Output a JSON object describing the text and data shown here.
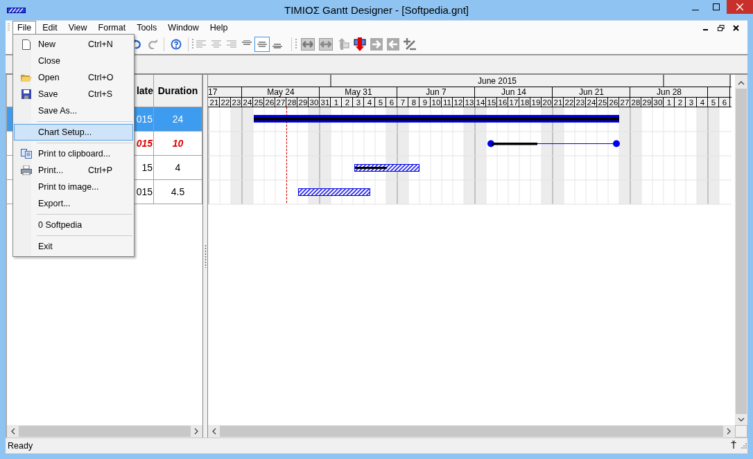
{
  "window": {
    "title": "TIMIOΣ Gantt Designer - [Softpedia.gnt]"
  },
  "menu_bar": [
    {
      "label": "File",
      "selected": true
    },
    {
      "label": "Edit",
      "selected": false
    },
    {
      "label": "View",
      "selected": false
    },
    {
      "label": "Format",
      "selected": false
    },
    {
      "label": "Tools",
      "selected": false
    },
    {
      "label": "Window",
      "selected": false
    },
    {
      "label": "Help",
      "selected": false
    }
  ],
  "file_menu": {
    "groups": [
      [
        {
          "label": "New",
          "shortcut": "Ctrl+N",
          "selected": false
        },
        {
          "label": "Close",
          "selected": false
        },
        {
          "label": "Open",
          "shortcut": "Ctrl+O",
          "selected": false
        },
        {
          "label": "Save",
          "shortcut": "Ctrl+S",
          "selected": false
        },
        {
          "label": "Save As...",
          "selected": false
        }
      ],
      [
        {
          "label": "Chart Setup...",
          "selected": true
        }
      ],
      [
        {
          "label": "Print to clipboard...",
          "selected": false
        },
        {
          "label": "Print...",
          "shortcut": "Ctrl+P",
          "selected": false
        },
        {
          "label": "Print to image...",
          "selected": false
        },
        {
          "label": "Export...",
          "selected": false
        }
      ],
      [
        {
          "label": "0 Softpedia",
          "selected": false
        }
      ],
      [
        {
          "label": "Exit",
          "selected": false
        }
      ]
    ]
  },
  "toolbar": {
    "align_buttons": [
      {
        "selected": false
      },
      {
        "selected": false
      },
      {
        "selected": false
      },
      {
        "selected": false
      },
      {
        "selected": true
      },
      {
        "selected": false
      }
    ]
  },
  "grid": {
    "columns": [
      "late",
      "Duration"
    ],
    "rows": [
      {
        "cells": [
          "015",
          "24"
        ],
        "selected": true,
        "critical": false
      },
      {
        "cells": [
          "015",
          "10"
        ],
        "selected": false,
        "critical": true
      },
      {
        "cells": [
          "15",
          "4"
        ],
        "selected": false,
        "critical": false
      },
      {
        "cells": [
          "015",
          "4.5"
        ],
        "selected": false,
        "critical": false
      }
    ]
  },
  "chart": {
    "months": [
      "June 2015"
    ],
    "weeks": [
      "17",
      "May 24",
      "May 31",
      "Jun 7",
      "Jun 14",
      "Jun 21",
      "Jun 28"
    ],
    "days": [
      {
        "label": "21",
        "weekend": false
      },
      {
        "label": "22",
        "weekend": false
      },
      {
        "label": "23",
        "weekend": true
      },
      {
        "label": "24",
        "weekend": true
      },
      {
        "label": "25",
        "weekend": false
      },
      {
        "label": "26",
        "weekend": false
      },
      {
        "label": "27",
        "weekend": false
      },
      {
        "label": "28",
        "weekend": false
      },
      {
        "label": "29",
        "weekend": false
      },
      {
        "label": "30",
        "weekend": true
      },
      {
        "label": "31",
        "weekend": true
      },
      {
        "label": "1",
        "weekend": false
      },
      {
        "label": "2",
        "weekend": false
      },
      {
        "label": "3",
        "weekend": false
      },
      {
        "label": "4",
        "weekend": false
      },
      {
        "label": "5",
        "weekend": false
      },
      {
        "label": "6",
        "weekend": true
      },
      {
        "label": "7",
        "weekend": true
      },
      {
        "label": "8",
        "weekend": false
      },
      {
        "label": "9",
        "weekend": false
      },
      {
        "label": "10",
        "weekend": false
      },
      {
        "label": "11",
        "weekend": false
      },
      {
        "label": "12",
        "weekend": false
      },
      {
        "label": "13",
        "weekend": true
      },
      {
        "label": "14",
        "weekend": true
      },
      {
        "label": "15",
        "weekend": false
      },
      {
        "label": "16",
        "weekend": false
      },
      {
        "label": "17",
        "weekend": false
      },
      {
        "label": "18",
        "weekend": false
      },
      {
        "label": "19",
        "weekend": false
      },
      {
        "label": "20",
        "weekend": true
      },
      {
        "label": "21",
        "weekend": true
      },
      {
        "label": "22",
        "weekend": false
      },
      {
        "label": "23",
        "weekend": false
      },
      {
        "label": "24",
        "weekend": false
      },
      {
        "label": "25",
        "weekend": false
      },
      {
        "label": "26",
        "weekend": false
      },
      {
        "label": "27",
        "weekend": true
      },
      {
        "label": "28",
        "weekend": true
      },
      {
        "label": "29",
        "weekend": false
      },
      {
        "label": "30",
        "weekend": false
      },
      {
        "label": "1",
        "weekend": false
      },
      {
        "label": "2",
        "weekend": false
      },
      {
        "label": "3",
        "weekend": false
      },
      {
        "label": "4",
        "weekend": true
      },
      {
        "label": "5",
        "weekend": true
      },
      {
        "label": "6",
        "weekend": false
      }
    ],
    "tasks": [
      {
        "kind": "summary"
      },
      {
        "kind": "range",
        "level": 0.37
      },
      {
        "kind": "task",
        "level": 0.49
      },
      {
        "kind": "task"
      }
    ]
  },
  "status_bar": {
    "text": "Ready",
    "indicator": "Ť"
  }
}
